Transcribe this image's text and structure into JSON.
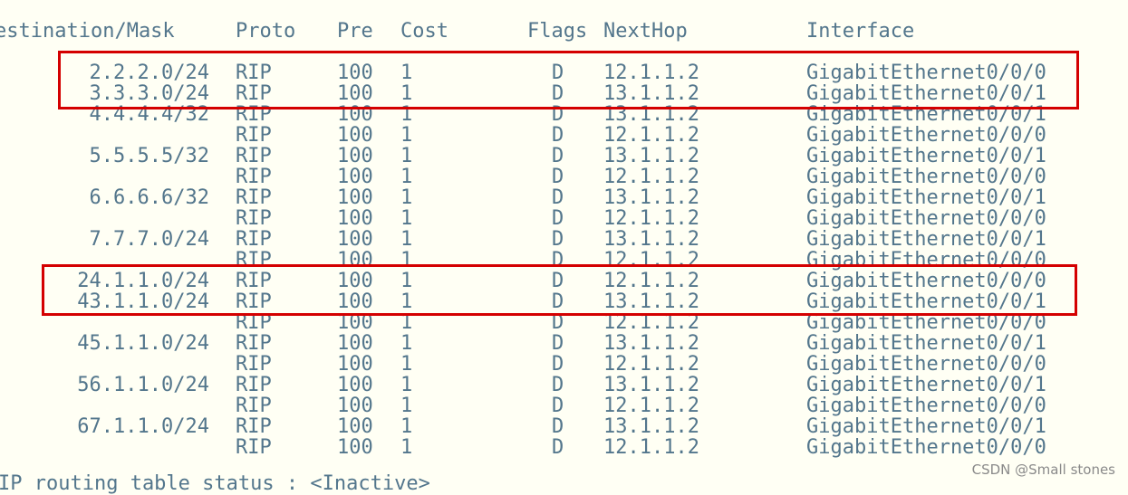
{
  "headers": {
    "dest": "estination/Mask",
    "proto": "Proto",
    "pre": "Pre",
    "cost": "Cost",
    "flags": "Flags",
    "nexthop": "NextHop",
    "iface": "Interface"
  },
  "rows": [
    {
      "dest": "2.2.2.0/24",
      "proto": "RIP",
      "pre": "100",
      "cost": "1",
      "flags": "D",
      "nexthop": "12.1.1.2",
      "iface": "GigabitEthernet0/0/0"
    },
    {
      "dest": "3.3.3.0/24",
      "proto": "RIP",
      "pre": "100",
      "cost": "1",
      "flags": "D",
      "nexthop": "13.1.1.2",
      "iface": "GigabitEthernet0/0/1"
    },
    {
      "dest": "4.4.4.4/32",
      "proto": "RIP",
      "pre": "100",
      "cost": "1",
      "flags": "D",
      "nexthop": "13.1.1.2",
      "iface": "GigabitEthernet0/0/1"
    },
    {
      "dest": "",
      "proto": "RIP",
      "pre": "100",
      "cost": "1",
      "flags": "D",
      "nexthop": "12.1.1.2",
      "iface": "GigabitEthernet0/0/0"
    },
    {
      "dest": "5.5.5.5/32",
      "proto": "RIP",
      "pre": "100",
      "cost": "1",
      "flags": "D",
      "nexthop": "13.1.1.2",
      "iface": "GigabitEthernet0/0/1"
    },
    {
      "dest": "",
      "proto": "RIP",
      "pre": "100",
      "cost": "1",
      "flags": "D",
      "nexthop": "12.1.1.2",
      "iface": "GigabitEthernet0/0/0"
    },
    {
      "dest": "6.6.6.6/32",
      "proto": "RIP",
      "pre": "100",
      "cost": "1",
      "flags": "D",
      "nexthop": "13.1.1.2",
      "iface": "GigabitEthernet0/0/1"
    },
    {
      "dest": "",
      "proto": "RIP",
      "pre": "100",
      "cost": "1",
      "flags": "D",
      "nexthop": "12.1.1.2",
      "iface": "GigabitEthernet0/0/0"
    },
    {
      "dest": "7.7.7.0/24",
      "proto": "RIP",
      "pre": "100",
      "cost": "1",
      "flags": "D",
      "nexthop": "13.1.1.2",
      "iface": "GigabitEthernet0/0/1"
    },
    {
      "dest": "",
      "proto": "RIP",
      "pre": "100",
      "cost": "1",
      "flags": "D",
      "nexthop": "12.1.1.2",
      "iface": "GigabitEthernet0/0/0"
    },
    {
      "dest": "24.1.1.0/24",
      "proto": "RIP",
      "pre": "100",
      "cost": "1",
      "flags": "D",
      "nexthop": "12.1.1.2",
      "iface": "GigabitEthernet0/0/0"
    },
    {
      "dest": "43.1.1.0/24",
      "proto": "RIP",
      "pre": "100",
      "cost": "1",
      "flags": "D",
      "nexthop": "13.1.1.2",
      "iface": "GigabitEthernet0/0/1"
    },
    {
      "dest": "",
      "proto": "RIP",
      "pre": "100",
      "cost": "1",
      "flags": "D",
      "nexthop": "12.1.1.2",
      "iface": "GigabitEthernet0/0/0"
    },
    {
      "dest": "45.1.1.0/24",
      "proto": "RIP",
      "pre": "100",
      "cost": "1",
      "flags": "D",
      "nexthop": "13.1.1.2",
      "iface": "GigabitEthernet0/0/1"
    },
    {
      "dest": "",
      "proto": "RIP",
      "pre": "100",
      "cost": "1",
      "flags": "D",
      "nexthop": "12.1.1.2",
      "iface": "GigabitEthernet0/0/0"
    },
    {
      "dest": "56.1.1.0/24",
      "proto": "RIP",
      "pre": "100",
      "cost": "1",
      "flags": "D",
      "nexthop": "13.1.1.2",
      "iface": "GigabitEthernet0/0/1"
    },
    {
      "dest": "",
      "proto": "RIP",
      "pre": "100",
      "cost": "1",
      "flags": "D",
      "nexthop": "12.1.1.2",
      "iface": "GigabitEthernet0/0/0"
    },
    {
      "dest": "67.1.1.0/24",
      "proto": "RIP",
      "pre": "100",
      "cost": "1",
      "flags": "D",
      "nexthop": "13.1.1.2",
      "iface": "GigabitEthernet0/0/1"
    },
    {
      "dest": "",
      "proto": "RIP",
      "pre": "100",
      "cost": "1",
      "flags": "D",
      "nexthop": "12.1.1.2",
      "iface": "GigabitEthernet0/0/0"
    }
  ],
  "footer_partial": "IP routing table status : <Inactive>",
  "watermark": "CSDN @Small stones",
  "colors": {
    "text": "#53768c",
    "background": "#fffff4",
    "highlight_box": "#d40000"
  }
}
